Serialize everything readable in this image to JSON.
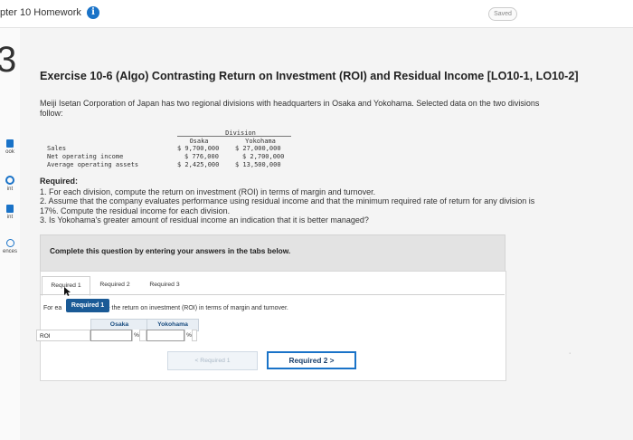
{
  "header": {
    "breadcrumb": "pter 10 Homework",
    "info_icon_glyph": "i",
    "saved_label": "Saved"
  },
  "left_rail": {
    "question_number": "3",
    "items": [
      {
        "label": "ook",
        "icon": "book-icon"
      },
      {
        "label": "int",
        "icon": "check-icon"
      },
      {
        "label": "int",
        "icon": "print-icon"
      },
      {
        "label": "ences",
        "icon": "references-icon"
      }
    ]
  },
  "exercise": {
    "title": "Exercise 10-6 (Algo) Contrasting Return on Investment (ROI) and Residual Income [LO10-1, LO10-2]",
    "intro": "Meiji Isetan Corporation of Japan has two regional divisions with headquarters in Osaka and Yokohama. Selected data on the two divisions follow:"
  },
  "division_table": {
    "group_header": "Division",
    "columns": [
      "Osaka",
      "Yokohama"
    ],
    "rows": [
      {
        "label": "Sales",
        "osaka": "$ 9,700,000",
        "yokohama": "$ 27,000,000"
      },
      {
        "label": "Net operating income",
        "osaka": "$ 776,000",
        "yokohama": "$ 2,700,000"
      },
      {
        "label": "Average operating assets",
        "osaka": "$ 2,425,000",
        "yokohama": "$ 13,500,000"
      }
    ]
  },
  "required": {
    "heading": "Required:",
    "items": [
      "1. For each division, compute the return on investment (ROI) in terms of margin and turnover.",
      "2. Assume that the company evaluates performance using residual income and that the minimum required rate of return for any division is 17%. Compute the residual income for each division.",
      "3. Is Yokohama's greater amount of residual income an indication that it is better managed?"
    ]
  },
  "banner": {
    "text": "Complete this question by entering your answers in the tabs below."
  },
  "tabs": [
    "Required 1",
    "Required 2",
    "Required 3"
  ],
  "tooltip": "Required 1",
  "instruction_prefix": "For ea",
  "instruction_suffix": "ompute the return on investment (ROI) in terms of margin and turnover.",
  "answer_table": {
    "columns": [
      "Osaka",
      "Yokohama"
    ],
    "row_label": "ROI",
    "unit": "%",
    "osaka_value": "",
    "yokohama_value": ""
  },
  "nav": {
    "prev_label": "< Required 1",
    "next_label": "Required 2  >"
  },
  "colors": {
    "accent": "#1a73c8",
    "banner_bg": "#e3e3e3",
    "tooltip_bg": "#1a5a96"
  }
}
